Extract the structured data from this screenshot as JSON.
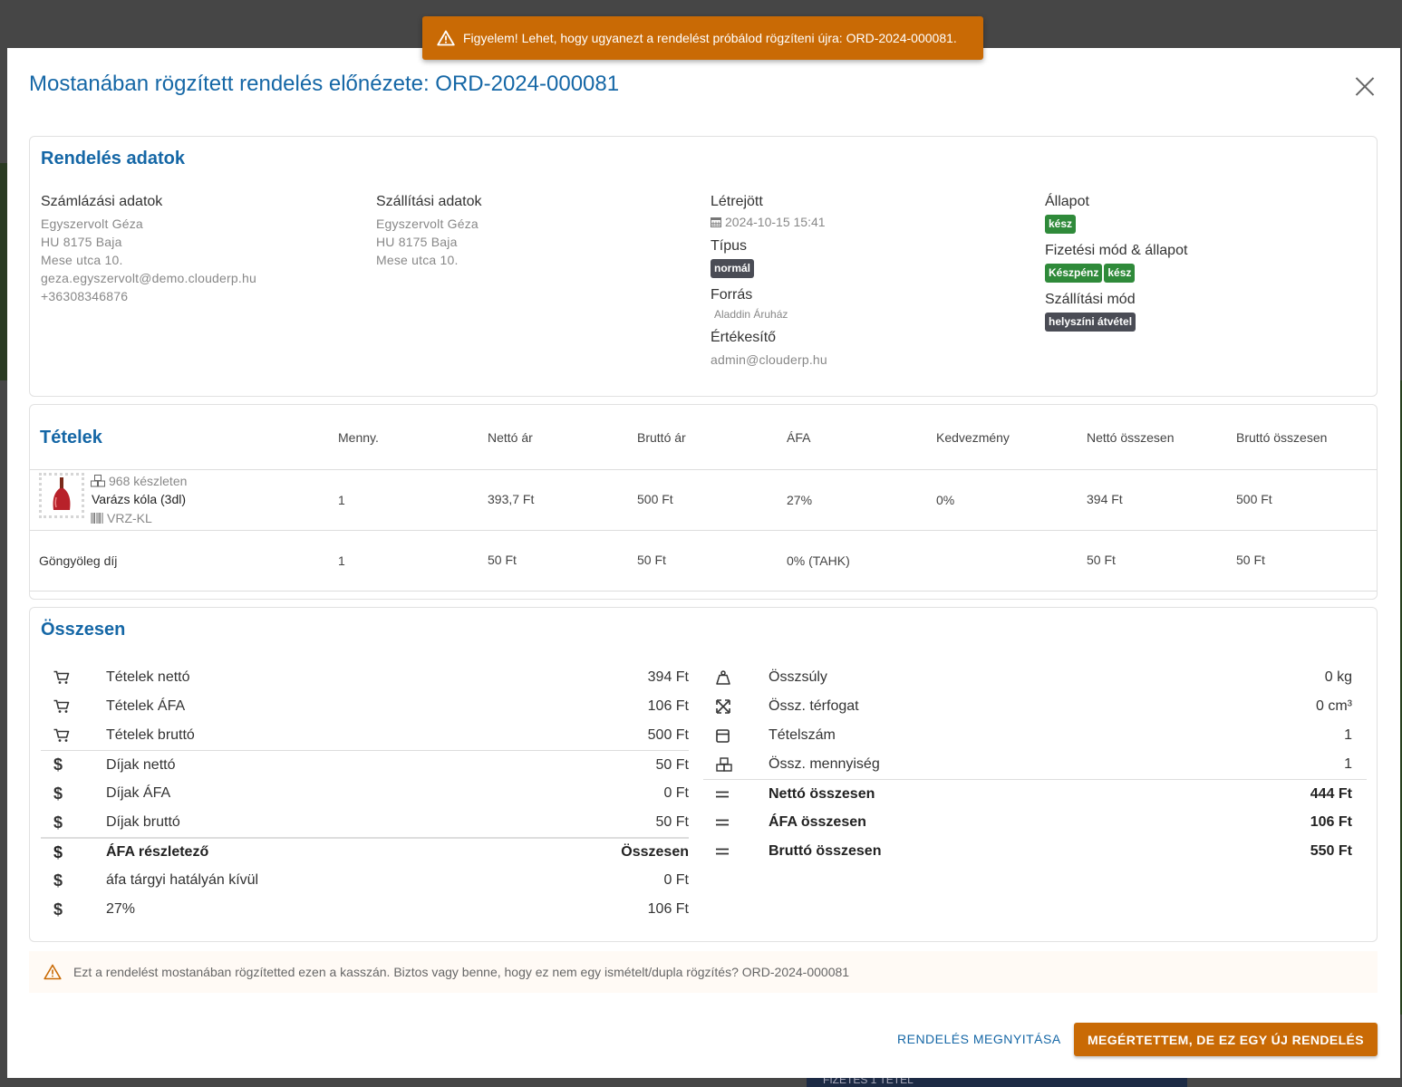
{
  "toast": {
    "text": "Figyelem! Lehet, hogy ugyanezt a rendelést próbálod rögzíteni újra: ORD-2024-000081.",
    "icon": "warning-icon"
  },
  "background": {
    "bottom_text": "FIZETÉS   1 TÉTEL"
  },
  "modal": {
    "title": "Mostanában rögzített rendelés előnézete: ORD-2024-000081"
  },
  "order": {
    "title": "Rendelés adatok",
    "billing": {
      "label": "Számlázási adatok",
      "lines": [
        "Egyszervolt Géza",
        "HU 8175 Baja",
        "Mese utca 10.",
        "geza.egyszervolt@demo.clouderp.hu",
        "+36308346876"
      ]
    },
    "shipping": {
      "label": "Szállítási adatok",
      "lines": [
        "Egyszervolt Géza",
        "HU 8175 Baja",
        "Mese utca 10."
      ]
    },
    "created": {
      "label": "Létrejött",
      "value": "2024-10-15 15:41",
      "icon": "calendar-icon"
    },
    "type": {
      "label": "Típus",
      "badge": "normál"
    },
    "source": {
      "label": "Forrás",
      "value": "Aladdin Áruház"
    },
    "seller": {
      "label": "Értékesítő",
      "value": "admin@clouderp.hu"
    },
    "status": {
      "label": "Állapot",
      "badge": "kész"
    },
    "payment": {
      "label": "Fizetési mód & állapot",
      "method": "Készpénz",
      "state": "kész"
    },
    "delivery": {
      "label": "Szállítási mód",
      "badge": "helyszíni átvétel"
    }
  },
  "items": {
    "title": "Tételek",
    "headers": [
      "Menny.",
      "Nettó ár",
      "Bruttó ár",
      "ÁFA",
      "Kedvezmény",
      "Nettó összesen",
      "Bruttó összesen"
    ],
    "product": {
      "stock": "968 készleten",
      "name": "Varázs kóla (3dl)",
      "sku": "VRZ-KL",
      "cells": [
        "1",
        "393,7 Ft",
        "500 Ft",
        "27%",
        "0%",
        "394 Ft",
        "500 Ft"
      ]
    },
    "fee": {
      "name": "Göngyöleg díj",
      "cells": [
        "1",
        "50 Ft",
        "50 Ft",
        "0% (TAHK)",
        "",
        "50 Ft",
        "50 Ft"
      ]
    }
  },
  "totals": {
    "title": "Összesen",
    "left": [
      {
        "icon": "cart-icon",
        "name": "Tételek nettó",
        "amount": "394 Ft"
      },
      {
        "icon": "cart-icon",
        "name": "Tételek ÁFA",
        "amount": "106 Ft"
      },
      {
        "icon": "cart-icon",
        "name": "Tételek bruttó",
        "amount": "500 Ft"
      },
      {
        "icon": "dollar-icon",
        "name": "Díjak nettó",
        "amount": "50 Ft"
      },
      {
        "icon": "dollar-icon",
        "name": "Díjak ÁFA",
        "amount": "0 Ft"
      },
      {
        "icon": "dollar-icon",
        "name": "Díjak bruttó",
        "amount": "50 Ft"
      },
      {
        "icon": "dollar-icon",
        "name": "ÁFA részletező",
        "amount": "Összesen"
      },
      {
        "icon": "dollar-icon",
        "name": "áfa tárgyi hatályán kívül",
        "amount": "0 Ft"
      },
      {
        "icon": "dollar-icon",
        "name": "27%",
        "amount": "106 Ft"
      }
    ],
    "right": [
      {
        "icon": "weight-icon",
        "name": "Összsúly",
        "amount": "0 kg"
      },
      {
        "icon": "expand-icon",
        "name": "Össz. térfogat",
        "amount": "0 cm³"
      },
      {
        "icon": "box-icon",
        "name": "Tételszám",
        "amount": "1"
      },
      {
        "icon": "boxes-icon",
        "name": "Össz. mennyiség",
        "amount": "1"
      },
      {
        "icon": "equals-icon",
        "name": "Nettó összesen",
        "amount": "444 Ft"
      },
      {
        "icon": "equals-icon",
        "name": "ÁFA összesen",
        "amount": "106 Ft"
      },
      {
        "icon": "equals-icon",
        "name": "Bruttó összesen",
        "amount": "550 Ft"
      }
    ]
  },
  "warning": {
    "text": "Ezt a rendelést mostanában rögzítetted ezen a kasszán. Biztos vagy benne, hogy ez nem egy ismételt/dupla rögzítés? ORD-2024-000081"
  },
  "actions": {
    "open_label": "RENDELÉS MEGNYITÁSA",
    "confirm_label": "MEGÉRTETTEM, DE EZ EGY ÚJ RENDELÉS"
  },
  "colors": {
    "accent": "#1567a6",
    "warning": "#c96a05",
    "success": "#2f8a3a",
    "badge_dark": "#4a4c55"
  }
}
